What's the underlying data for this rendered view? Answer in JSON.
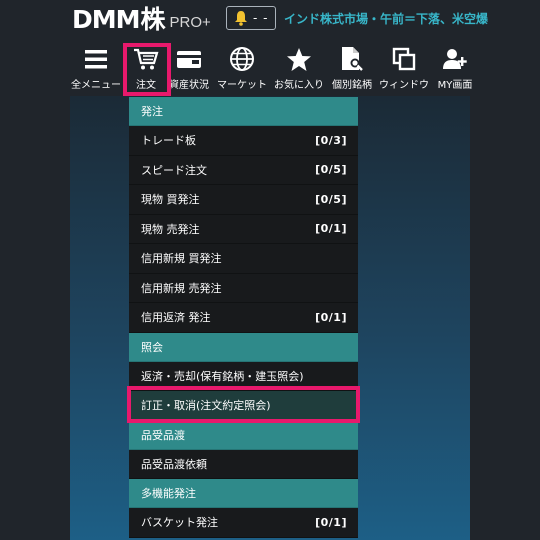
{
  "header": {
    "logo_dmm": "DMM",
    "logo_kabu": "株",
    "logo_pro": "PRO+",
    "notification_count": "- -",
    "ticker_text": "インド株式市場・午前＝下落、米空爆"
  },
  "nav": [
    {
      "label": "全メニュー",
      "icon": "hamburger-icon"
    },
    {
      "label": "注文",
      "icon": "cart-icon"
    },
    {
      "label": "資産状況",
      "icon": "wallet-icon"
    },
    {
      "label": "マーケット",
      "icon": "globe-icon"
    },
    {
      "label": "お気に入り",
      "icon": "star-icon"
    },
    {
      "label": "個別銘柄",
      "icon": "document-search-icon"
    },
    {
      "label": "ウィンドウ",
      "icon": "windows-icon"
    },
    {
      "label": "MY画面",
      "icon": "user-add-icon"
    }
  ],
  "menu": {
    "sections": [
      {
        "title": "発注",
        "items": [
          {
            "label": "トレード板",
            "count": "[0/3]"
          },
          {
            "label": "スピード注文",
            "count": "[0/5]"
          },
          {
            "label": "現物 買発注",
            "count": "[0/5]"
          },
          {
            "label": "現物 売発注",
            "count": "[0/1]"
          },
          {
            "label": "信用新規 買発注",
            "count": ""
          },
          {
            "label": "信用新規 売発注",
            "count": ""
          },
          {
            "label": "信用返済 発注",
            "count": "[0/1]"
          }
        ]
      },
      {
        "title": "照会",
        "items": [
          {
            "label": "返済・売却(保有銘柄・建玉照会)",
            "count": ""
          },
          {
            "label": "訂正・取消(注文約定照会)",
            "count": ""
          }
        ]
      },
      {
        "title": "品受品渡",
        "items": [
          {
            "label": "品受品渡依頼",
            "count": ""
          }
        ]
      },
      {
        "title": "多機能発注",
        "items": [
          {
            "label": "バスケット発注",
            "count": "[0/1]"
          }
        ]
      }
    ]
  },
  "colors": {
    "highlight": "#e8196c",
    "section_bg": "#2f8a8a",
    "ticker": "#38b6c9"
  }
}
